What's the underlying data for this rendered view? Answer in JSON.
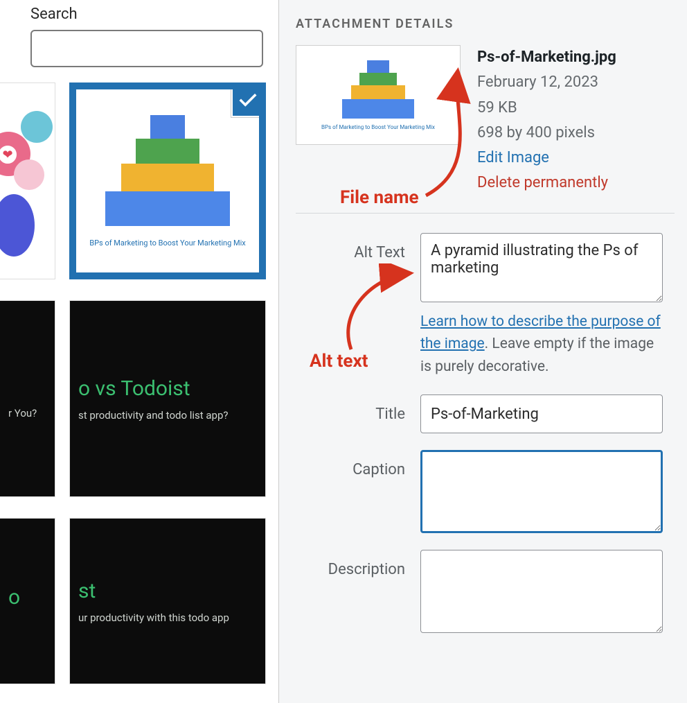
{
  "search": {
    "label": "Search",
    "value": ""
  },
  "thumbnails": {
    "selected_caption": "BPs of Marketing to Boost Your Marketing Mix",
    "black1": {
      "title": "o vs Todoist",
      "sub": "st productivity and todo list app?",
      "left_sub": "r You?"
    },
    "black2": {
      "title_left": "o",
      "title_right": "st",
      "sub": "ur productivity with this todo app"
    }
  },
  "details": {
    "heading": "ATTACHMENT DETAILS",
    "filename": "Ps-of-Marketing.jpg",
    "date": "February 12, 2023",
    "size": "59 KB",
    "dimensions": "698 by 400 pixels",
    "edit": "Edit Image",
    "delete": "Delete permanently"
  },
  "fields": {
    "alt_label": "Alt Text",
    "alt_value": "A pyramid illustrating the Ps of marketing",
    "alt_help_link": "Learn how to describe the purpose of the image",
    "alt_help_rest": ". Leave empty if the image is purely decorative.",
    "title_label": "Title",
    "title_value": "Ps-of-Marketing",
    "caption_label": "Caption",
    "caption_value": "",
    "description_label": "Description",
    "description_value": ""
  },
  "annotations": {
    "filename": "File name",
    "alttext": "Alt text"
  },
  "colors": {
    "accent": "#2271b1",
    "danger": "#c0392b",
    "annot": "#d6331e",
    "pyr1": "#4a7fe0",
    "pyr2": "#4ea34e",
    "pyr3": "#f0b330",
    "pyr4": "#4d87e8"
  }
}
